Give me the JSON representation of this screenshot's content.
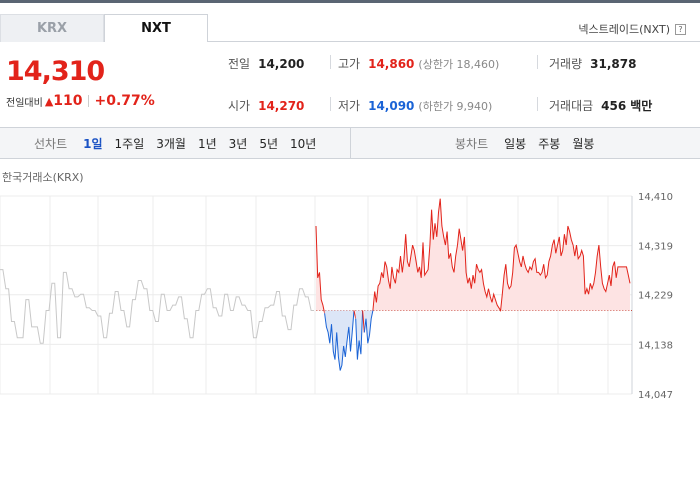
{
  "tabs": [
    {
      "label": "KRX",
      "active": false
    },
    {
      "label": "NXT",
      "active": true
    }
  ],
  "venue_label": "넥스트레이드(NXT)",
  "help_glyph": "?",
  "price": {
    "current": "14,310",
    "change_label": "전일대비",
    "change_arrow": "▲",
    "change": "110",
    "change_pct": "+0.77%"
  },
  "stats": {
    "prev_close": {
      "label": "전일",
      "value": "14,200"
    },
    "open": {
      "label": "시가",
      "value": "14,270"
    },
    "high": {
      "label": "고가",
      "value": "14,860",
      "limit_label": "(상한가 18,460)"
    },
    "low": {
      "label": "저가",
      "value": "14,090",
      "limit_label": "(하한가 9,940)"
    },
    "volume": {
      "label": "거래량",
      "value": "31,878"
    },
    "amount": {
      "label": "거래대금",
      "value": "456",
      "unit": "백만"
    }
  },
  "toolbar": {
    "line_label": "선차트",
    "periods": [
      {
        "label": "1일",
        "selected": true
      },
      {
        "label": "1주일",
        "selected": false
      },
      {
        "label": "3개월",
        "selected": false
      },
      {
        "label": "1년",
        "selected": false
      },
      {
        "label": "3년",
        "selected": false
      },
      {
        "label": "5년",
        "selected": false
      },
      {
        "label": "10년",
        "selected": false
      }
    ],
    "candle_label": "봉차트",
    "candle_periods": [
      {
        "label": "일봉"
      },
      {
        "label": "주봉"
      },
      {
        "label": "월봉"
      }
    ]
  },
  "chart_label": "한국거래소(KRX)",
  "colors": {
    "up": "#e2231a",
    "down": "#1a63d6",
    "ghost": "#c8c8c8",
    "fill_up": "#fde3e3",
    "fill_down": "#dce6f7"
  },
  "chart_data": {
    "type": "line",
    "yticks": [
      "14,410",
      "14,319",
      "14,229",
      "14,138",
      "14,047"
    ],
    "ylim": [
      14047,
      14410
    ],
    "baseline": 14200,
    "grid": true,
    "ghost_series": [
      14275,
      14275,
      14240,
      14240,
      14180,
      14180,
      14150,
      14150,
      14150,
      14220,
      14220,
      14170,
      14170,
      14170,
      14140,
      14140,
      14200,
      14200,
      14250,
      14250,
      14150,
      14150,
      14270,
      14270,
      14240,
      14240,
      14225,
      14225,
      14230,
      14230,
      14205,
      14205,
      14200,
      14200,
      14190,
      14190,
      14150,
      14150,
      14195,
      14195,
      14235,
      14235,
      14200,
      14200,
      14170,
      14170,
      14220,
      14220,
      14255,
      14255,
      14240,
      14240,
      14200,
      14200,
      14180,
      14180,
      14230,
      14230,
      14200,
      14200,
      14210,
      14210,
      14225,
      14225,
      14185,
      14185,
      14150,
      14150,
      14200,
      14200,
      14230,
      14230,
      14240,
      14240,
      14205,
      14205,
      14190,
      14190,
      14230,
      14230,
      14200,
      14200,
      14225,
      14225,
      14210,
      14210,
      14200,
      14200,
      14150,
      14150,
      14180,
      14180,
      14205,
      14205,
      14210,
      14210,
      14235,
      14235,
      14190,
      14190,
      14165,
      14165,
      14210,
      14210,
      14240,
      14240,
      14225,
      14225,
      14200,
      14200
    ],
    "series": [
      14355,
      14260,
      14270,
      14220,
      14210,
      14195,
      14170,
      14160,
      14140,
      14175,
      14125,
      14110,
      14160,
      14115,
      14090,
      14100,
      14135,
      14115,
      14145,
      14170,
      14125,
      14160,
      14200,
      14185,
      14110,
      14145,
      14120,
      14200,
      14160,
      14185,
      14140,
      14155,
      14185,
      14200,
      14235,
      14215,
      14245,
      14250,
      14270,
      14260,
      14290,
      14280,
      14255,
      14240,
      14280,
      14260,
      14250,
      14275,
      14270,
      14300,
      14270,
      14295,
      14340,
      14290,
      14280,
      14300,
      14320,
      14310,
      14290,
      14270,
      14280,
      14260,
      14325,
      14265,
      14270,
      14275,
      14320,
      14385,
      14330,
      14360,
      14335,
      14380,
      14405,
      14355,
      14335,
      14320,
      14345,
      14295,
      14305,
      14280,
      14270,
      14300,
      14320,
      14350,
      14330,
      14310,
      14335,
      14270,
      14250,
      14260,
      14240,
      14265,
      14250,
      14285,
      14275,
      14270,
      14275,
      14250,
      14235,
      14225,
      14240,
      14225,
      14215,
      14230,
      14220,
      14210,
      14205,
      14200,
      14230,
      14265,
      14285,
      14250,
      14240,
      14245,
      14270,
      14315,
      14320,
      14305,
      14290,
      14280,
      14300,
      14285,
      14275,
      14270,
      14280,
      14275,
      14290,
      14295,
      14270,
      14270,
      14265,
      14270,
      14285,
      14260,
      14265,
      14290,
      14300,
      14320,
      14330,
      14305,
      14320,
      14335,
      14300,
      14310,
      14340,
      14320,
      14355,
      14345,
      14330,
      14320,
      14300,
      14320,
      14295,
      14300,
      14310,
      14300,
      14230,
      14240,
      14230,
      14250,
      14240,
      14250,
      14270,
      14300,
      14320,
      14280,
      14250,
      14240,
      14235,
      14250,
      14265,
      14245,
      14280,
      14290,
      14260,
      14280,
      14280,
      14280,
      14280,
      14280,
      14280,
      14265,
      14250
    ]
  }
}
